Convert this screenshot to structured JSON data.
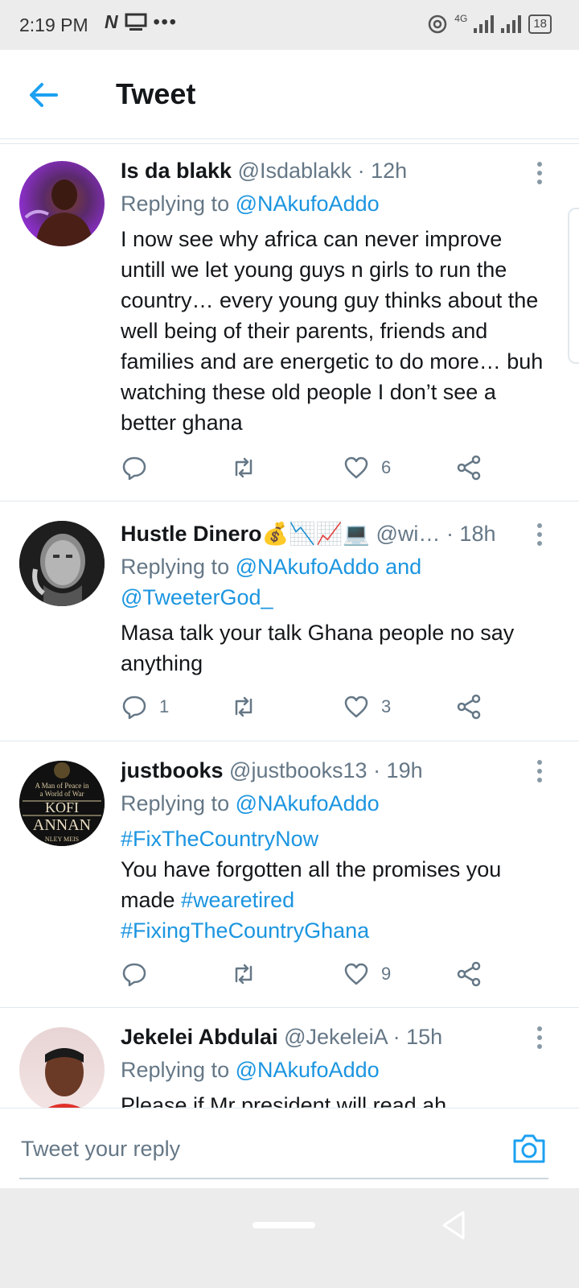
{
  "status_bar": {
    "time": "2:19 PM",
    "network": "4G",
    "battery": "18"
  },
  "header": {
    "title": "Tweet"
  },
  "tweets": [
    {
      "name": "Is da blakk",
      "handle": "@Isdablakk",
      "time": "· 12h",
      "replying_prefix": "Replying to",
      "replying_to": "@NAkufoAddo",
      "text": "I now see why africa can never improve untill we let young guys n girls to run the country… every young guy thinks about the well being of their parents, friends and families and are energetic to do more… buh watching these old people I don’t see a better ghana",
      "replies": "",
      "retweets": "",
      "likes": "6"
    },
    {
      "name": "Hustle Dinero💰📉📈💻",
      "handle": "@wi…",
      "time": "· 18h",
      "replying_prefix": "Replying to",
      "replying_to": "@NAkufoAddo and @TweeterGod_",
      "text": "Masa talk your talk Ghana people no say anything",
      "replies": "1",
      "retweets": "",
      "likes": "3"
    },
    {
      "name": "justbooks",
      "handle": "@justbooks13",
      "time": "· 19h",
      "replying_prefix": "Replying to",
      "replying_to": "@NAkufoAddo",
      "hashtag_line": "#FixTheCountryNow",
      "text_before": "You have forgotten all the promises you made ",
      "hashtag_inline": "#wearetired",
      "hashtag_last": "#FixingTheCountryGhana",
      "avatar_text_1": "A Man of Peace in",
      "avatar_text_2": "a World of War",
      "avatar_text_3": "KOFI",
      "avatar_text_4": "ANNAN",
      "avatar_text_5": "NLEY MEIS",
      "replies": "",
      "retweets": "",
      "likes": "9"
    },
    {
      "name": "Jekelei Abdulai",
      "handle": "@JekeleiA",
      "time": "· 15h",
      "replying_prefix": "Replying to",
      "replying_to": "@NAkufoAddo",
      "text": "Please if Mr president will read ah"
    }
  ],
  "reply_bar": {
    "placeholder": "Tweet your reply"
  },
  "icons": {
    "back": "arrow-left-icon",
    "more": "more-vertical-icon",
    "reply": "comment-icon",
    "retweet": "retweet-icon",
    "like": "heart-icon",
    "share": "share-icon",
    "camera": "camera-icon"
  },
  "colors": {
    "accent": "#1da1f2",
    "link": "#1b95e0",
    "secondary_text": "#657786"
  }
}
